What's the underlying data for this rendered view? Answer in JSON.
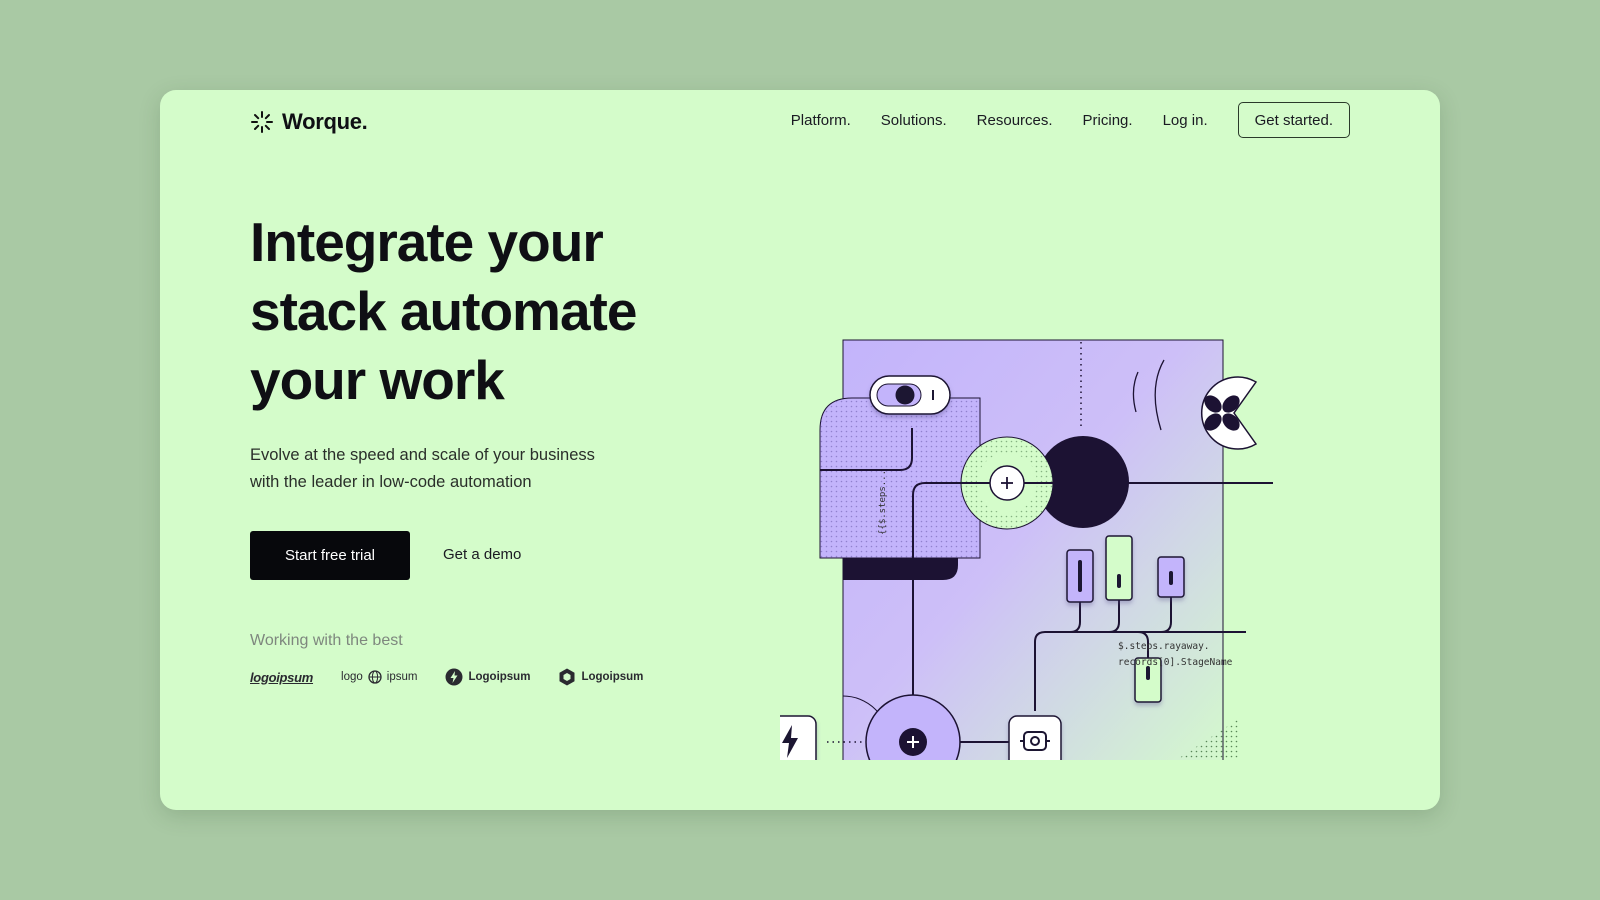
{
  "brand": {
    "name": "Worque.",
    "icon": "sparkle-burst-icon"
  },
  "nav": {
    "items": [
      "Platform.",
      "Solutions.",
      "Resources.",
      "Pricing.",
      "Log in."
    ],
    "cta": "Get started."
  },
  "hero": {
    "headline_lines": [
      "Integrate your",
      "stack automate",
      "your work"
    ],
    "subhead_lines": [
      "Evolve at the speed and scale of your business",
      "with the leader in low-code automation"
    ],
    "primary_cta": "Start free trial",
    "secondary_cta": "Get a demo"
  },
  "partners": {
    "title": "Working with the best",
    "logos": [
      {
        "text": "logoipsum",
        "icon": "script-logo"
      },
      {
        "text": "logo",
        "text2": "ipsum",
        "icon": "globe-icon"
      },
      {
        "text": "Logoipsum",
        "icon": "bolt-circle-icon"
      },
      {
        "text": "Logoipsum",
        "icon": "hexagon-icon"
      }
    ]
  },
  "illustration": {
    "code_snippet": [
      "$.steps.rayaway.",
      "records[0].StageName"
    ],
    "steps_label": "{{$.steps...",
    "icons": [
      "toggle-switch-icon",
      "plus-icon",
      "plus-icon",
      "lightning-bolt-icon",
      "camera-icon",
      "propeller-icon"
    ]
  },
  "colors": {
    "page_bg": "#a9c9a4",
    "card_bg": "#d4fcca",
    "accent_purple": "#c5b8fb",
    "dark": "#1c1233",
    "black": "#07080c"
  }
}
